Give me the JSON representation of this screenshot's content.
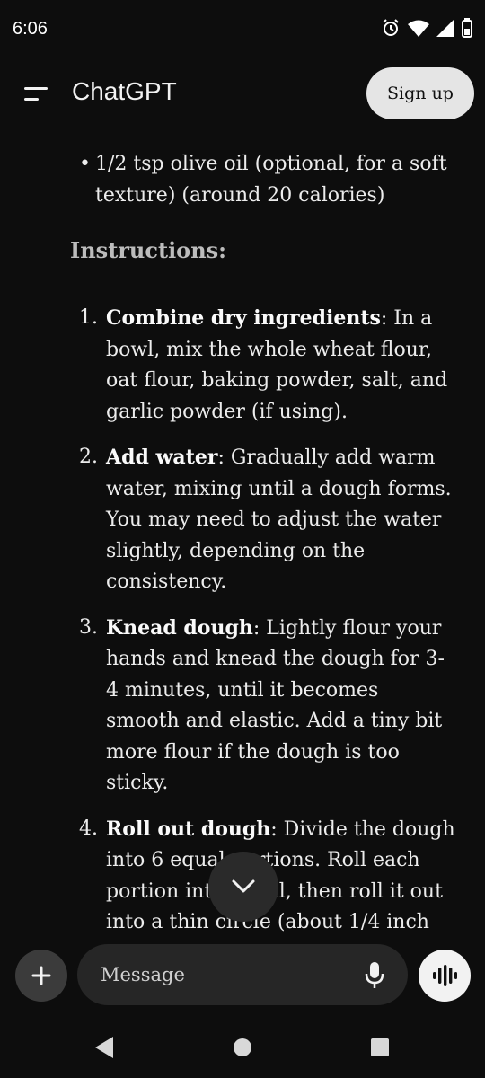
{
  "status_bar": {
    "time": "6:06",
    "icons": [
      "alarm-icon",
      "wifi-icon",
      "signal-icon",
      "battery-icon"
    ]
  },
  "header": {
    "title": "ChatGPT",
    "signup_label": "Sign up"
  },
  "content": {
    "bullet": {
      "marker": "•",
      "text": "1/2 tsp olive oil (optional, for a soft texture) (around 20 calories)"
    },
    "heading": "Instructions:",
    "steps": [
      {
        "number": "1.",
        "title": "Combine dry ingredients",
        "text": ": In a bowl, mix the whole wheat flour, oat flour, baking powder, salt, and garlic powder (if using)."
      },
      {
        "number": "2.",
        "title": "Add water",
        "text": ": Gradually add warm water, mixing until a dough forms. You may need to adjust the water slightly, depending on the consistency."
      },
      {
        "number": "3.",
        "title": "Knead dough",
        "text": ": Lightly flour your hands and knead the dough for 3-4 minutes, until it becomes smooth and elastic. Add a tiny bit more flour if the dough is too sticky."
      },
      {
        "number": "4.",
        "title": "Roll out dough",
        "text": ": Divide the dough into 6 equal portions. Roll each portion into a ball, then roll it out into a thin circle (about 1/4 inch"
      }
    ]
  },
  "composer": {
    "placeholder": "Message"
  },
  "nav_bar": {
    "buttons": [
      "back-icon",
      "home-icon",
      "recents-icon"
    ]
  }
}
